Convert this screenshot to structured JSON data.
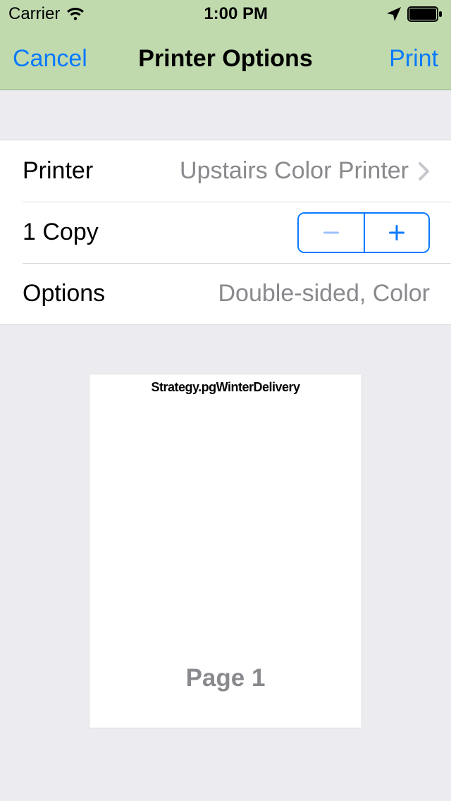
{
  "status": {
    "carrier": "Carrier",
    "time": "1:00 PM"
  },
  "nav": {
    "cancel": "Cancel",
    "title": "Printer Options",
    "print": "Print"
  },
  "rows": {
    "printer_label": "Printer",
    "printer_value": "Upstairs Color Printer",
    "copies_label": "1 Copy",
    "options_label": "Options",
    "options_value": "Double-sided, Color"
  },
  "preview": {
    "page_label": "Page 1",
    "thumb_text": "Strategy.pgWinterDelivery"
  }
}
